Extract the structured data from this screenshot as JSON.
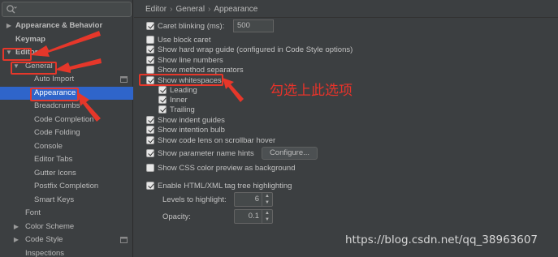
{
  "sidebar": {
    "search": {
      "value": "",
      "placeholder": ""
    },
    "items": [
      {
        "label": "Appearance & Behavior",
        "arrow": "▶"
      },
      {
        "label": "Keymap",
        "arrow": ""
      },
      {
        "label": "Editor",
        "arrow": "▼"
      },
      {
        "label": "General",
        "arrow": "▼"
      },
      {
        "label": "Auto Import",
        "arrow": ""
      },
      {
        "label": "Appearance",
        "arrow": ""
      },
      {
        "label": "Breadcrumbs",
        "arrow": ""
      },
      {
        "label": "Code Completion",
        "arrow": ""
      },
      {
        "label": "Code Folding",
        "arrow": ""
      },
      {
        "label": "Console",
        "arrow": ""
      },
      {
        "label": "Editor Tabs",
        "arrow": ""
      },
      {
        "label": "Gutter Icons",
        "arrow": ""
      },
      {
        "label": "Postfix Completion",
        "arrow": ""
      },
      {
        "label": "Smart Keys",
        "arrow": ""
      },
      {
        "label": "Font",
        "arrow": ""
      },
      {
        "label": "Color Scheme",
        "arrow": "▶"
      },
      {
        "label": "Code Style",
        "arrow": "▶"
      },
      {
        "label": "Inspections",
        "arrow": ""
      }
    ]
  },
  "breadcrumb": [
    "Editor",
    "General",
    "Appearance"
  ],
  "options": {
    "caret_blinking": {
      "label": "Caret blinking (ms):",
      "checked": true,
      "value": "500"
    },
    "use_block_caret": {
      "label": "Use block caret",
      "checked": false
    },
    "show_hard_wrap": {
      "label": "Show hard wrap guide (configured in Code Style options)",
      "checked": true
    },
    "show_line_numbers": {
      "label": "Show line numbers",
      "checked": true
    },
    "show_method_separators": {
      "label": "Show method separators",
      "checked": false
    },
    "show_whitespaces": {
      "label": "Show whitespaces",
      "checked": true
    },
    "leading": {
      "label": "Leading",
      "checked": true
    },
    "inner": {
      "label": "Inner",
      "checked": true
    },
    "trailing": {
      "label": "Trailing",
      "checked": true
    },
    "show_indent_guides": {
      "label": "Show indent guides",
      "checked": true
    },
    "show_intention_bulb": {
      "label": "Show intention bulb",
      "checked": true
    },
    "show_code_lens": {
      "label": "Show code lens on scrollbar hover",
      "checked": true
    },
    "show_param_hints": {
      "label": "Show parameter name hints",
      "checked": true,
      "button": "Configure..."
    },
    "show_css_color": {
      "label": "Show CSS color preview as background",
      "checked": false
    },
    "enable_html_tree": {
      "label": "Enable HTML/XML tag tree highlighting",
      "checked": true
    },
    "levels": {
      "label": "Levels to highlight:",
      "value": "6"
    },
    "opacity": {
      "label": "Opacity:",
      "value": "0.1"
    }
  },
  "annotation": "勾选上此选项",
  "watermark": "https://blog.csdn.net/qq_38963607",
  "colors": {
    "selection": "#2f65ca",
    "highlight": "#e6372a",
    "background": "#3c3f41"
  }
}
